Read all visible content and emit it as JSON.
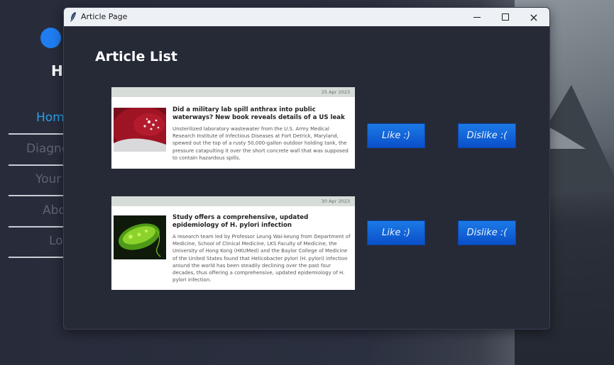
{
  "background_app": {
    "title_partial": "Ho",
    "nav": [
      {
        "label": "Home",
        "active": true
      },
      {
        "label": "Diagno",
        "active": false
      },
      {
        "label": "Your",
        "active": false
      },
      {
        "label": "Abo",
        "active": false
      },
      {
        "label": "Lo",
        "active": false
      }
    ]
  },
  "window": {
    "title": "Article Page",
    "icon": "feather-icon",
    "controls": {
      "minimize": "minimize-icon",
      "maximize": "maximize-icon",
      "close": "×"
    }
  },
  "page": {
    "title": "Article List",
    "articles": [
      {
        "date": "25 Apr 2023",
        "title": "Did a military lab spill anthrax into public waterways? New book reveals details of a US leak",
        "body": "Unsterilized laboratory wastewater from the U.S. Army Medical Research Institute of Infectious Diseases at Fort Detrick, Maryland, spewed out the top of a rusty 50,000-gallon outdoor holding tank, the pressure catapulting it over the short concrete wall that was supposed to contain hazardous spills.",
        "image": "bacteria-petri-dish-image",
        "like_label": "Like :)",
        "dislike_label": "Dislike :("
      },
      {
        "date": "30 Apr 2023",
        "title": "Study offers a comprehensive, updated epidemiology of H. pylori infection",
        "body": "A research team led by Professor Leung Wai-keung from Department of Medicine, School of Clinical Medicine, LKS Faculty of Medicine, the University of Hong Kong (HKUMed) and the Baylor College of Medicine of the United States found that Helicobacter pylori (H. pylori) infection around the world has been steadily declining over the past four decades, thus offering a comprehensive, updated epidemiology of H. pylori infection.",
        "image": "h-pylori-bacterium-image",
        "like_label": "Like :)",
        "dislike_label": "Dislike :("
      }
    ]
  },
  "colors": {
    "window_bg": "#262a37",
    "button_blue": "#0a4fc9",
    "nav_active": "#2aa0e8",
    "accent_dot": "#1f7df0"
  }
}
